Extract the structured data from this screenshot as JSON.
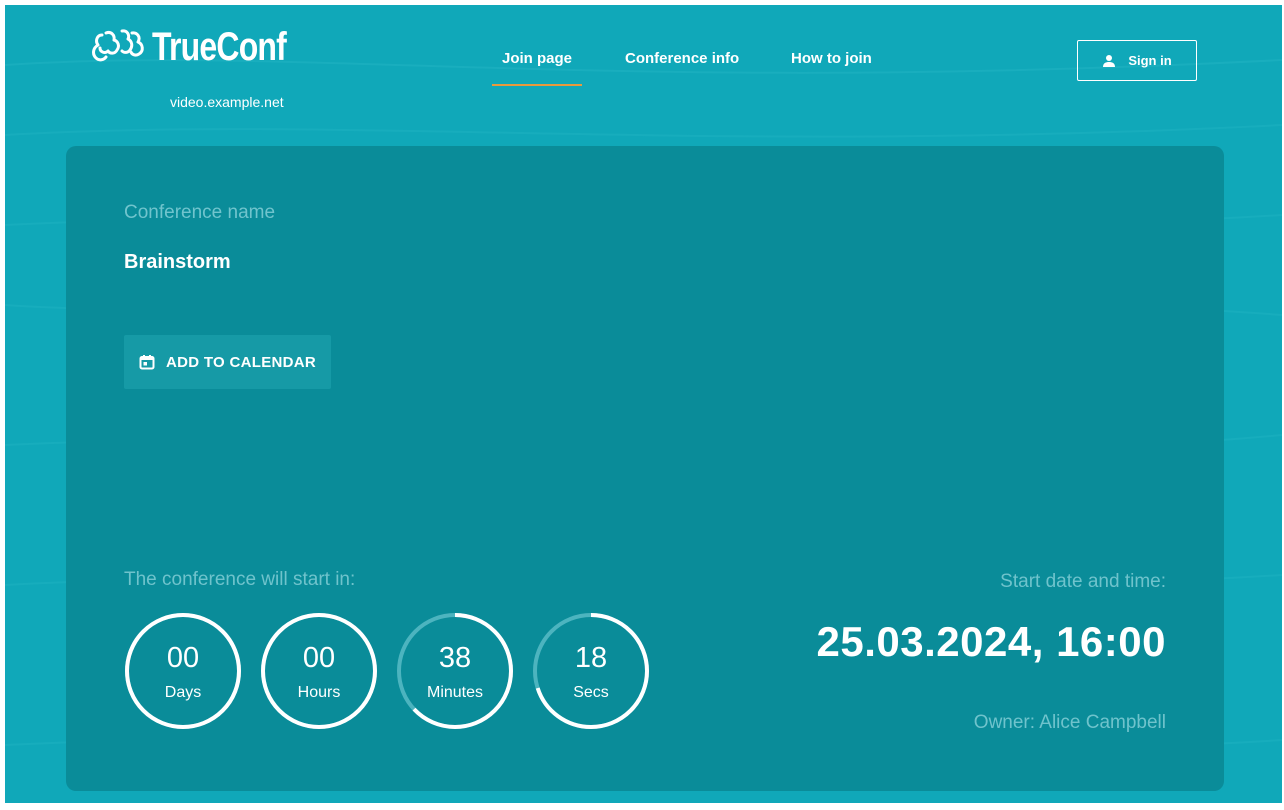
{
  "header": {
    "logo_text": "TrueConf",
    "domain": "video.example.net",
    "nav": [
      {
        "label": "Join page",
        "active": true
      },
      {
        "label": "Conference info",
        "active": false
      },
      {
        "label": "How to join",
        "active": false
      }
    ],
    "signin_label": "Sign in"
  },
  "conference": {
    "name_label": "Conference name",
    "name": "Brainstorm",
    "calendar_button": "ADD TO CALENDAR",
    "countdown_label": "The conference will start in:",
    "countdown": [
      {
        "value": "00",
        "unit": "Days",
        "progress": 1.0
      },
      {
        "value": "00",
        "unit": "Hours",
        "progress": 1.0
      },
      {
        "value": "38",
        "unit": "Minutes",
        "progress": 0.63
      },
      {
        "value": "18",
        "unit": "Secs",
        "progress": 0.7
      }
    ],
    "start_label": "Start date and time:",
    "start_value": "25.03.2024, 16:00",
    "owner": "Owner: Alice Campbell"
  },
  "icons": {
    "logo": "people-group-icon",
    "signin": "user-icon",
    "calendar": "calendar-icon"
  },
  "colors": {
    "background": "#10a8b9",
    "card": "#0a8c99",
    "accent": "#e89a3c",
    "muted_text": "#6fc3cc"
  }
}
